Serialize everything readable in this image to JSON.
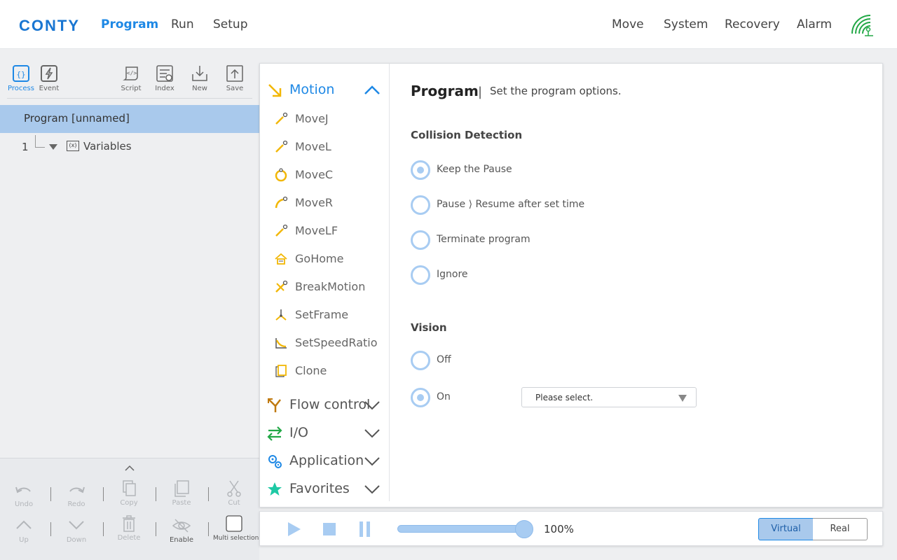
{
  "app": {
    "logo": "CONTY"
  },
  "nav": {
    "left": [
      "Program",
      "Run",
      "Setup"
    ],
    "right": [
      "Move",
      "System",
      "Recovery",
      "Alarm"
    ],
    "active": "Program"
  },
  "left_toolbar": {
    "process": "Process",
    "event": "Event",
    "script": "Script",
    "index": "Index",
    "new": "New",
    "save": "Save"
  },
  "tree": {
    "program": "Program [unnamed]",
    "rows": [
      {
        "num": "1",
        "label": "Variables"
      }
    ]
  },
  "edit": {
    "undo": "Undo",
    "redo": "Redo",
    "copy": "Copy",
    "paste": "Paste",
    "cut": "Cut",
    "up": "Up",
    "down": "Down",
    "delete": "Delete",
    "enable": "Enable",
    "multi": "Multi selection"
  },
  "commands": {
    "motion": "Motion",
    "motion_items": [
      "MoveJ",
      "MoveL",
      "MoveC",
      "MoveR",
      "MoveLF",
      "GoHome",
      "BreakMotion",
      "SetFrame",
      "SetSpeedRatio",
      "Clone"
    ],
    "flow": "Flow control",
    "io": "I/O",
    "application": "Application",
    "favorites": "Favorites"
  },
  "settings": {
    "title": "Program",
    "separator": "|",
    "subtitle": "Set the program options.",
    "collision": {
      "heading": "Collision Detection",
      "options": [
        "Keep the Pause",
        "Pause ⟩ Resume after set time",
        "Terminate program",
        "Ignore"
      ],
      "selected": "Keep the Pause"
    },
    "vision": {
      "heading": "Vision",
      "options": [
        "Off",
        "On"
      ],
      "selected": "On",
      "select_placeholder": "Please select."
    }
  },
  "player": {
    "speed": "100%",
    "mode_virtual": "Virtual",
    "mode_real": "Real",
    "speed_level": 1.0
  },
  "colors": {
    "accent": "#1e88e5",
    "selection": "#a9c9ec",
    "radio": "#a8ccf2",
    "icon_yellow": "#f2b705"
  }
}
